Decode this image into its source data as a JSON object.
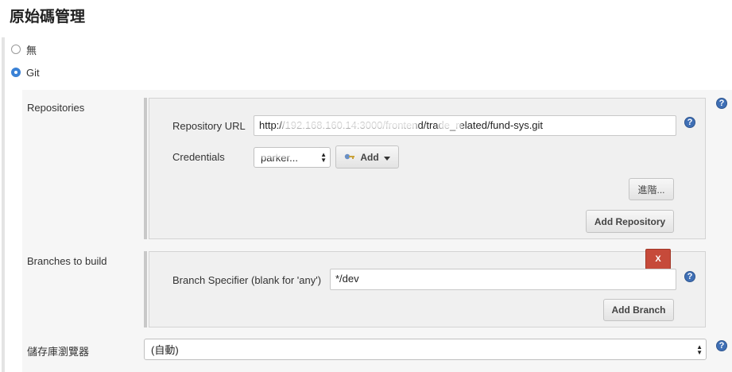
{
  "page_title": "原始碼管理",
  "scm_options": [
    {
      "label": "無",
      "selected": false
    },
    {
      "label": "Git",
      "selected": true
    }
  ],
  "repositories": {
    "label": "Repositories",
    "url_label": "Repository URL",
    "url_value": "http://192.168.160.14:3000/frontend/trade_related/fund-sys.git",
    "credentials_label": "Credentials",
    "credentials_value": "parker...",
    "add_label": "Add",
    "advanced_label": "進階...",
    "add_repository_label": "Add Repository"
  },
  "branches": {
    "label": "Branches to build",
    "delete_label": "X",
    "specifier_label": "Branch Specifier (blank for 'any')",
    "specifier_value": "*/dev",
    "add_branch_label": "Add Branch"
  },
  "browser": {
    "label": "儲存庫瀏覽器",
    "value": "(自動)"
  },
  "help_glyph": "?",
  "icons": {
    "help": "help-icon",
    "key": "key-icon",
    "dropdown": "chevron-down-icon"
  },
  "colors": {
    "accent": "#3b82d6",
    "help": "#3f6fb5",
    "delete": "#c64a3a"
  }
}
